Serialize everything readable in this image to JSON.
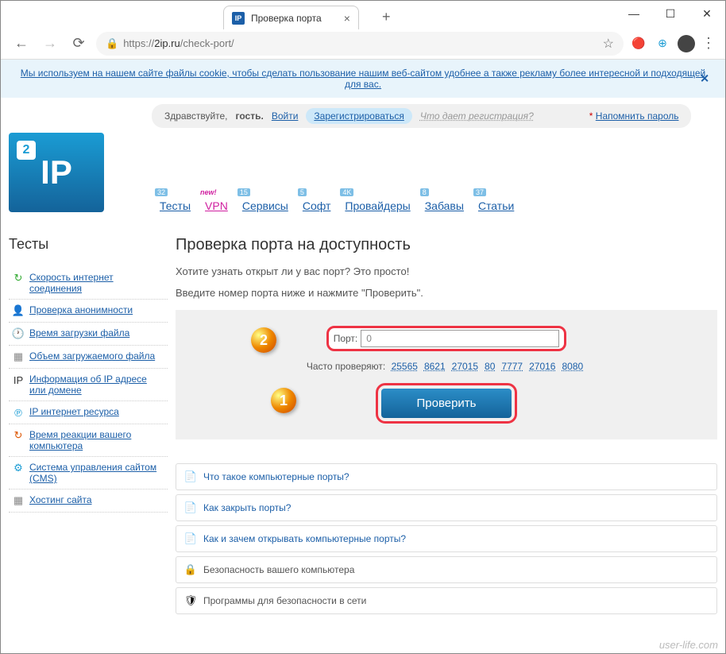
{
  "browser": {
    "tab_title": "Проверка порта",
    "url_prefix": "https://",
    "url_host": "2ip.ru",
    "url_path": "/check-port/"
  },
  "cookie": {
    "text": "Мы используем на нашем сайте файлы cookie, чтобы сделать пользование нашим веб-сайтом удобнее а также рекламу более интересной и подходящей для вас."
  },
  "login": {
    "greeting": "Здравствуйте,",
    "guest": "гость.",
    "login": "Войти",
    "register": "Зарегистрироваться",
    "hint": "Что дает регистрация?",
    "remind": "Напомнить пароль"
  },
  "logo": {
    "text": "IP",
    "badge": "2"
  },
  "nav": [
    {
      "label": "Тесты",
      "badge": "32"
    },
    {
      "label": "VPN",
      "new": "new!"
    },
    {
      "label": "Сервисы",
      "badge": "15"
    },
    {
      "label": "Софт",
      "badge": "5"
    },
    {
      "label": "Провайдеры",
      "badge": "4K"
    },
    {
      "label": "Забавы",
      "badge": "8"
    },
    {
      "label": "Статьи",
      "badge": "37"
    }
  ],
  "sidebar": {
    "title": "Тесты",
    "items": [
      {
        "icon": "↻",
        "label": "Скорость интернет соединения",
        "color": "#3a3"
      },
      {
        "icon": "👤",
        "label": "Проверка анонимности",
        "color": "#c77"
      },
      {
        "icon": "🕐",
        "label": "Время загрузки файла",
        "color": "#888"
      },
      {
        "icon": "▦",
        "label": "Объем загружаемого файла",
        "color": "#888"
      },
      {
        "icon": "IP",
        "label": "Информация об IP адресе или домене",
        "color": "#333"
      },
      {
        "icon": "℗",
        "label": "IP интернет ресурса",
        "color": "#1a9cd4"
      },
      {
        "icon": "↻",
        "label": "Время реакции вашего компьютера",
        "color": "#d50"
      },
      {
        "icon": "⚙",
        "label": "Система управления сайтом (CMS)",
        "color": "#1a9cd4"
      },
      {
        "icon": "▦",
        "label": "Хостинг сайта",
        "color": "#888"
      }
    ]
  },
  "main": {
    "title": "Проверка порта на доступность",
    "p1": "Хотите узнать открыт ли у вас порт? Это просто!",
    "p2": "Введите номер порта ниже и нажмите \"Проверить\".",
    "port_label": "Порт:",
    "port_value": "0",
    "freq_label": "Часто проверяют:",
    "freq_ports": [
      "25565",
      "8621",
      "27015",
      "80",
      "7777",
      "27016",
      "8080"
    ],
    "button": "Проверить"
  },
  "faq": [
    {
      "icon": "📄",
      "label": "Что такое компьютерные порты?",
      "link": true
    },
    {
      "icon": "📄",
      "label": "Как закрыть порты?",
      "link": true
    },
    {
      "icon": "📄",
      "label": "Как и зачем открывать компьютерные порты?",
      "link": true
    },
    {
      "icon": "🔒",
      "label": "Безопасность вашего компьютера",
      "link": false
    },
    {
      "icon": "🛡",
      "label": "Программы для безопасности в сети",
      "link": false
    }
  ],
  "watermark": "user-life.com"
}
